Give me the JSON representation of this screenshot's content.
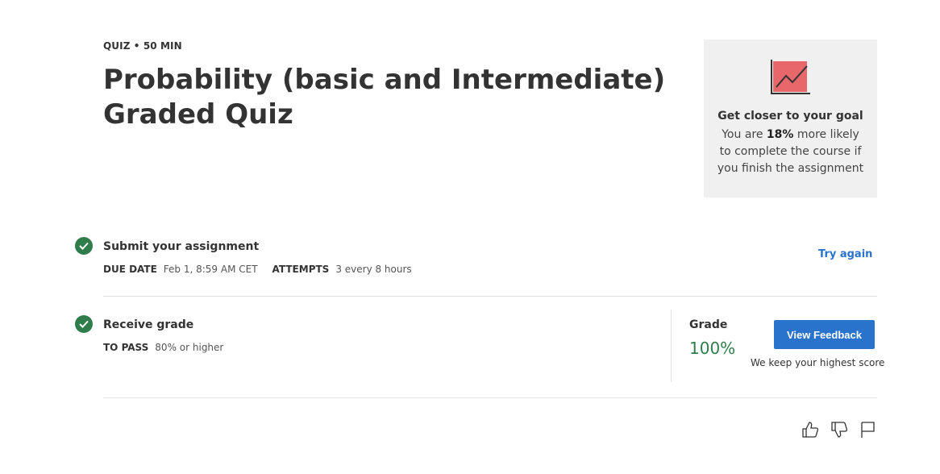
{
  "header": {
    "meta": "QUIZ • 50 MIN",
    "title": "Probability (basic and Intermediate) Graded Quiz"
  },
  "goal_card": {
    "icon": "line-chart-icon",
    "title": "Get closer to your goal",
    "text_prefix": "You are ",
    "highlight": "18%",
    "text_suffix": " more likely to complete the course if you finish the assignment",
    "accent_color": "#e8676b"
  },
  "submit_step": {
    "title": "Submit your assignment",
    "due_label": "DUE DATE",
    "due_value": "Feb 1, 8:59 AM CET",
    "attempts_label": "ATTEMPTS",
    "attempts_value": "3 every 8 hours",
    "try_again": "Try again"
  },
  "grade_step": {
    "title": "Receive grade",
    "pass_label": "TO PASS",
    "pass_value": "80% or higher",
    "grade_label": "Grade",
    "grade_value": "100%",
    "feedback_button": "View Feedback",
    "note": "We keep your highest score"
  },
  "feedback_icons": [
    "thumbs-up-icon",
    "thumbs-down-icon",
    "flag-icon"
  ],
  "colors": {
    "success": "#2e7d4a",
    "link": "#2a73cc",
    "card_bg": "#f0f0f0"
  }
}
